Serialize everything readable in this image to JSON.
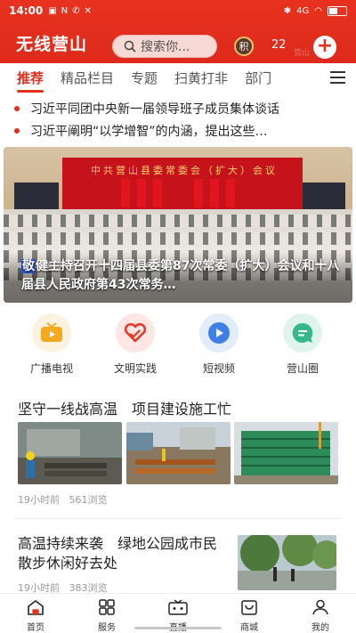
{
  "status_bar": {
    "time": "14:00",
    "left_icons": [
      "image-icon",
      "n-icon",
      "pin-icon",
      "tools-icon"
    ],
    "right_text": "4G",
    "battery_label": "49",
    "battery_level": 0.49
  },
  "header": {
    "logo": "无线营山",
    "search_placeholder": "搜索你...",
    "points_badge": "积",
    "points_count": "22",
    "add_label": "+",
    "watermark": "营山"
  },
  "tabs": [
    {
      "label": "推荐",
      "active": true
    },
    {
      "label": "精品栏目"
    },
    {
      "label": "专题"
    },
    {
      "label": "扫黄打非"
    },
    {
      "label": "部门"
    }
  ],
  "headlines": [
    "习近平同团中央新一届领导班子成员集体谈话",
    "习近平阐明“以学增智”的内涵，提出这些…"
  ],
  "banner": {
    "stage_title": "中共营山县委常委会（扩大）会议",
    "caption_lead": "敬",
    "caption": "健主持召开十四届县委第87次常委（扩大）会议和十八届县人民政府第43次常务…"
  },
  "entries": [
    {
      "label": "广播电视",
      "icon": "tv-icon",
      "color": "#f4a91e",
      "bg": "#fdf2df"
    },
    {
      "label": "文明实践",
      "icon": "heart-hand-icon",
      "color": "#e7382a",
      "bg": "#fde6e3"
    },
    {
      "label": "短视频",
      "icon": "play-icon",
      "color": "#3f7fe6",
      "bg": "#e3ecfb"
    },
    {
      "label": "营山圈",
      "icon": "chat-bubble-icon",
      "color": "#35b98a",
      "bg": "#dff4ec"
    }
  ],
  "article1": {
    "title": "坚守一线战高温　项目建设施工忙",
    "time": "19小时前",
    "views": "561浏览"
  },
  "article2": {
    "title": "高温持续来袭　绿地公园成市民散步休闲好去处",
    "time": "19小时前",
    "views": "383浏览"
  },
  "bottom_nav": [
    {
      "label": "首页",
      "icon": "home-icon",
      "active": true
    },
    {
      "label": "服务",
      "icon": "grid-icon"
    },
    {
      "label": "直播",
      "icon": "live-tv-icon"
    },
    {
      "label": "商城",
      "icon": "shop-icon"
    },
    {
      "label": "我的",
      "icon": "user-icon"
    }
  ],
  "colors": {
    "brand": "#e2301f"
  }
}
